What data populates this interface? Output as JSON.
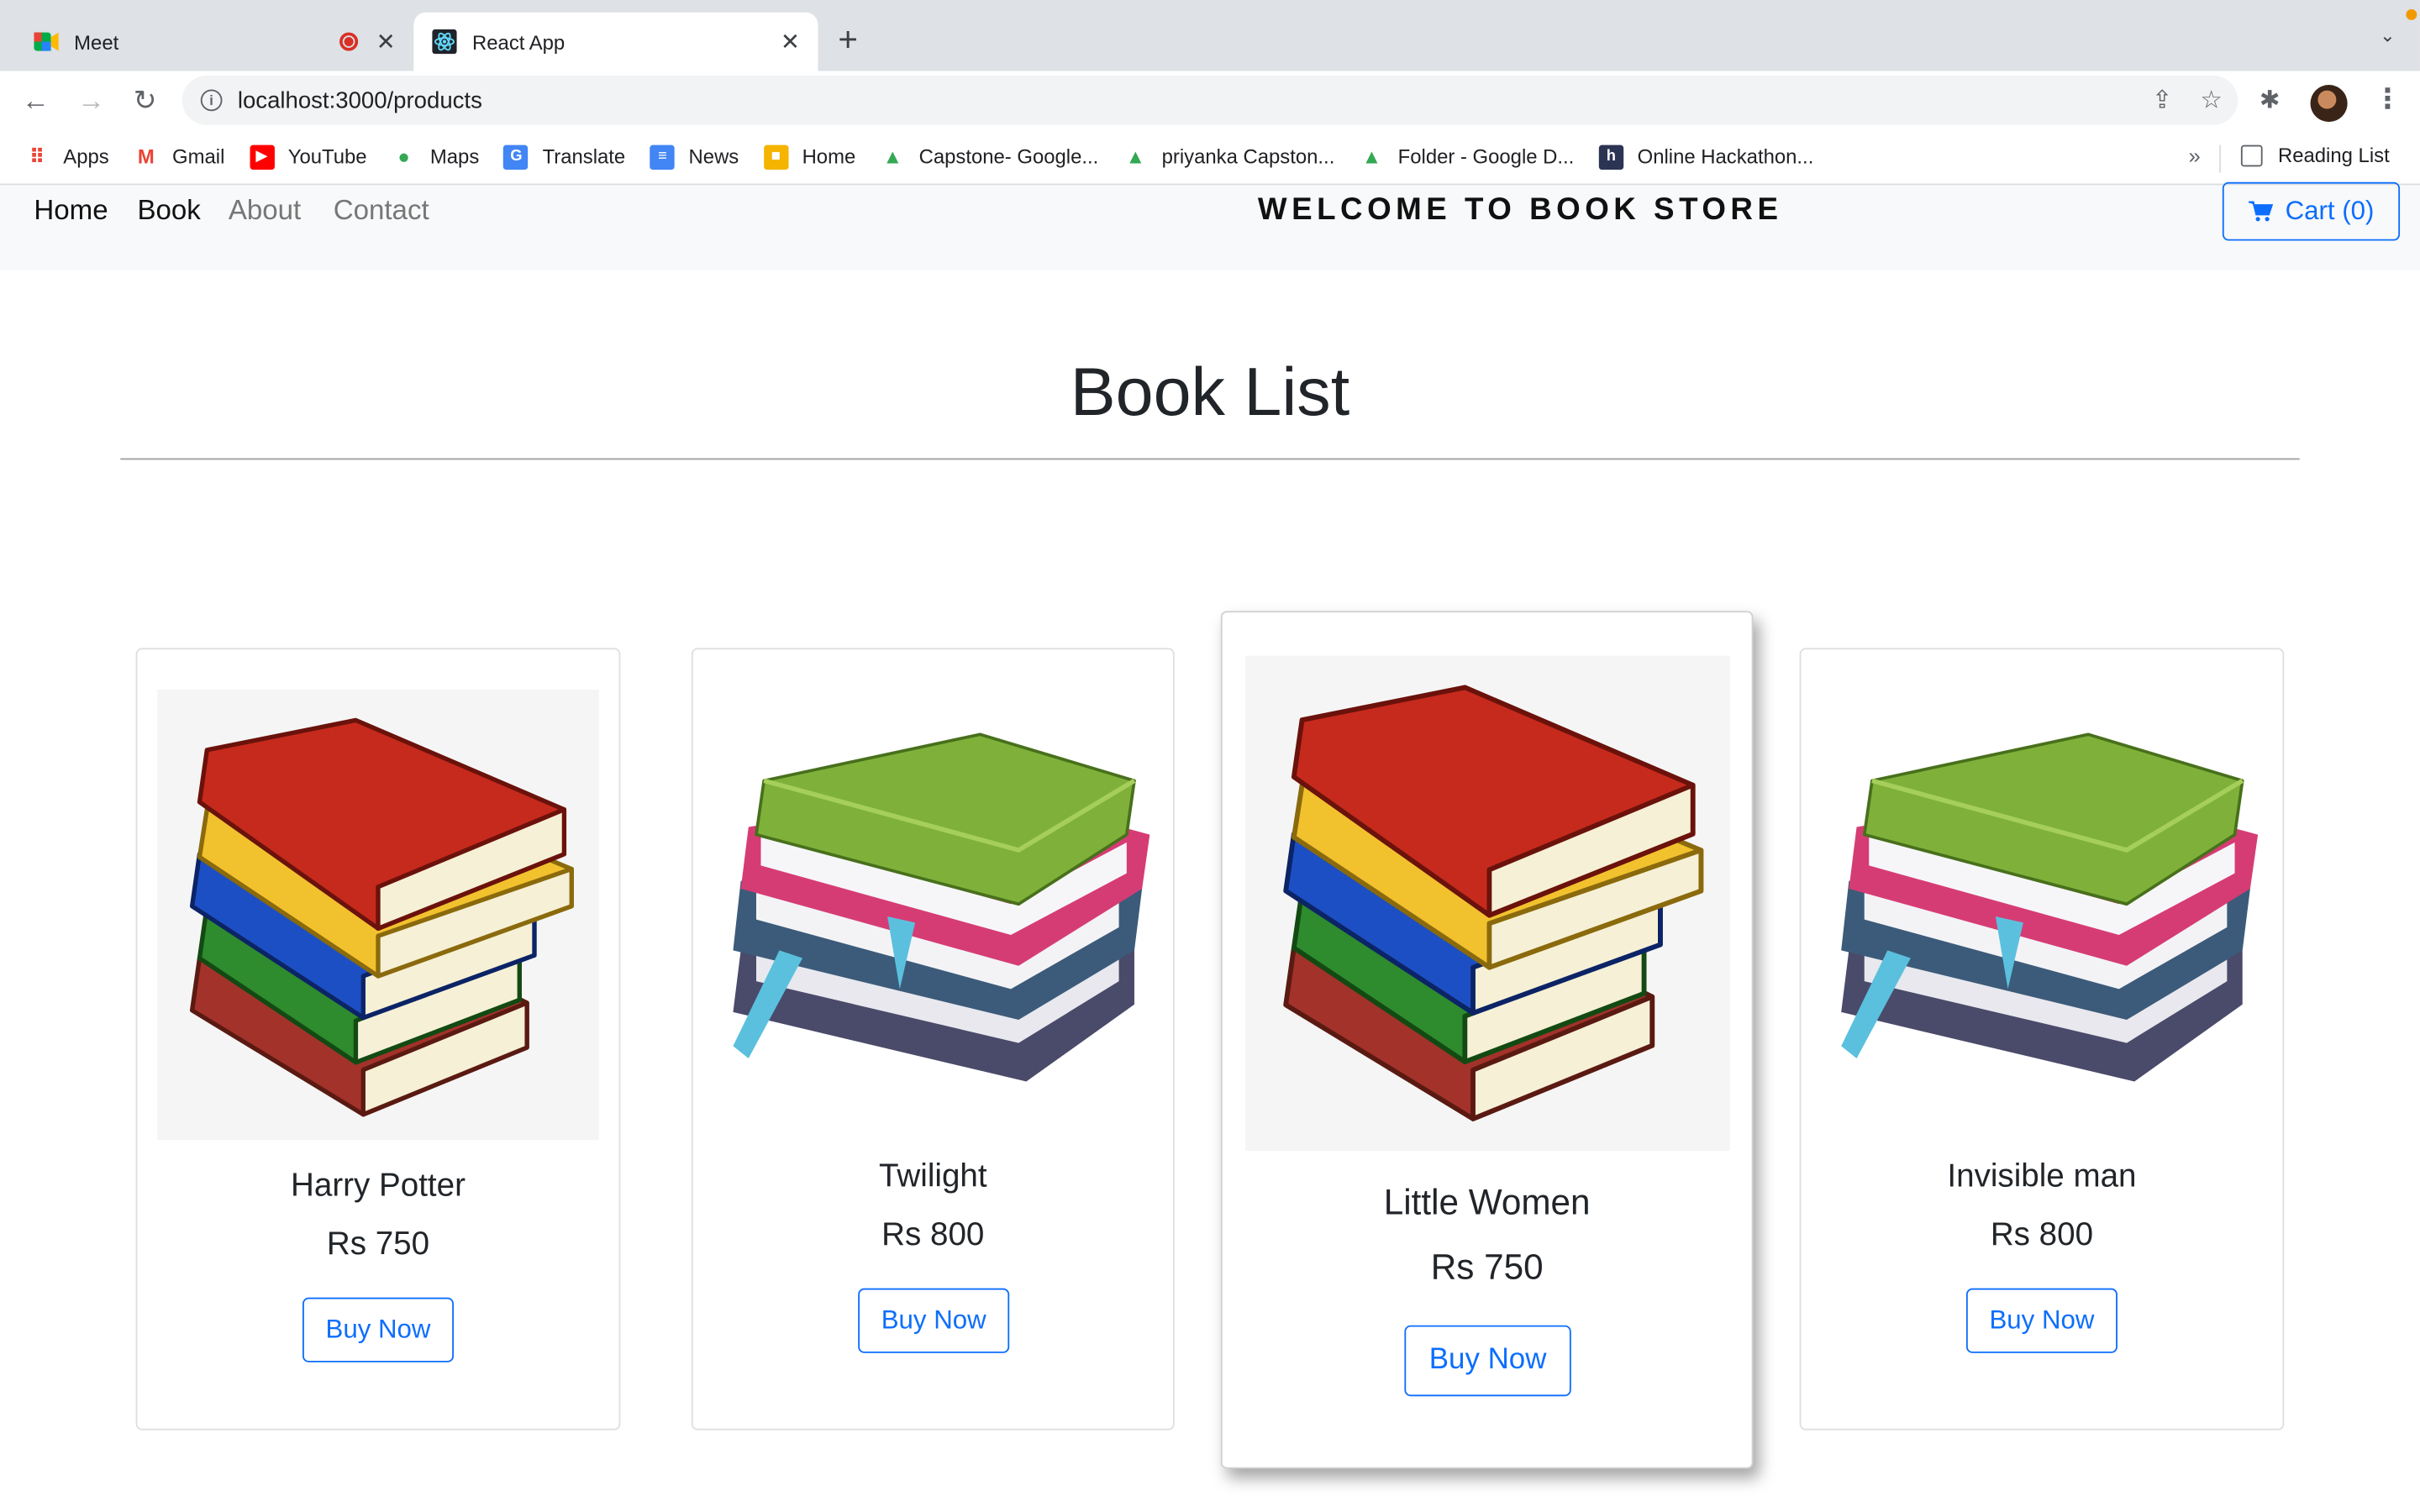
{
  "browser": {
    "tabs": [
      {
        "title": "Meet",
        "active": false,
        "recording": true
      },
      {
        "title": "React App",
        "active": true
      }
    ],
    "url": "localhost:3000/products",
    "bookmarks": [
      {
        "label": "Apps",
        "icon": "apps-grid-icon",
        "color": "#ea4335"
      },
      {
        "label": "Gmail",
        "icon": "gmail-icon",
        "color": "#ea4335"
      },
      {
        "label": "YouTube",
        "icon": "youtube-icon",
        "color": "#ff0000"
      },
      {
        "label": "Maps",
        "icon": "maps-pin-icon",
        "color": "#34a853"
      },
      {
        "label": "Translate",
        "icon": "translate-icon",
        "color": "#4285f4"
      },
      {
        "label": "News",
        "icon": "google-news-icon",
        "color": "#4285f4"
      },
      {
        "label": "Home",
        "icon": "package-icon",
        "color": "#f4b400"
      },
      {
        "label": "Capstone- Google...",
        "icon": "drive-icon",
        "color": "#34a853"
      },
      {
        "label": "priyanka Capston...",
        "icon": "drive-icon",
        "color": "#34a853"
      },
      {
        "label": "Folder - Google D...",
        "icon": "drive-icon",
        "color": "#34a853"
      },
      {
        "label": "Online Hackathon...",
        "icon": "hackerearth-icon",
        "color": "#2c3454"
      }
    ],
    "more_bookmarks": "»",
    "reading_list": "Reading List"
  },
  "site": {
    "nav": [
      "Home",
      "Book",
      "About",
      "Contact"
    ],
    "brand": "WELCOME TO BOOK STORE",
    "cart_label": "Cart (0)",
    "heading": "Book List",
    "accent": "#0d6efd"
  },
  "products": [
    {
      "name": "Harry Potter",
      "price": "Rs 750",
      "button": "Buy Now",
      "image": "stack-of-books-colorful"
    },
    {
      "name": "Twilight",
      "price": "Rs 800",
      "button": "Buy Now",
      "image": "stack-of-books-green"
    },
    {
      "name": "Little Women",
      "price": "Rs 750",
      "button": "Buy Now",
      "image": "stack-of-books-colorful"
    },
    {
      "name": "Invisible man",
      "price": "Rs 800",
      "button": "Buy Now",
      "image": "stack-of-books-green"
    }
  ]
}
